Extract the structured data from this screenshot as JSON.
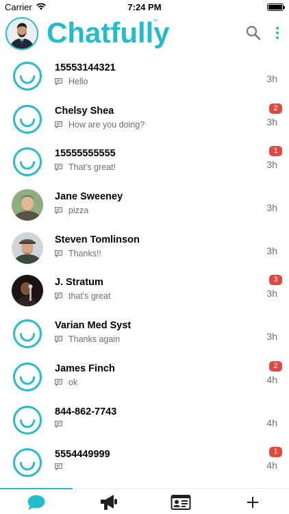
{
  "status_bar": {
    "carrier": "Carrier",
    "time": "7:24 PM"
  },
  "header": {
    "brand": "Chatfully",
    "brand_mark": "™"
  },
  "colors": {
    "accent": "#22bccd",
    "badge": "#e8453c",
    "secondary_text": "#6e6e6e"
  },
  "conversations": [
    {
      "name": "15553144321",
      "preview": "Hello",
      "time": "3h",
      "badge": "",
      "avatar": "smile-icon"
    },
    {
      "name": "Chelsy Shea",
      "preview": "How are you doing?",
      "time": "3h",
      "badge": "2",
      "avatar": "smile-icon"
    },
    {
      "name": "15555555555",
      "preview": "That's great!",
      "time": "3h",
      "badge": "1",
      "avatar": "smile-icon"
    },
    {
      "name": "Jane Sweeney",
      "preview": "pizza",
      "time": "3h",
      "badge": "",
      "avatar": "photo"
    },
    {
      "name": "Steven Tomlinson",
      "preview": "Thanks!!",
      "time": "3h",
      "badge": "",
      "avatar": "photo"
    },
    {
      "name": "J. Stratum",
      "preview": "that's great",
      "time": "3h",
      "badge": "3",
      "avatar": "photo"
    },
    {
      "name": "Varian Med Syst",
      "preview": "Thanks again",
      "time": "3h",
      "badge": "",
      "avatar": "smile-icon"
    },
    {
      "name": "James Finch",
      "preview": "ok",
      "time": "4h",
      "badge": "2",
      "avatar": "smile-icon"
    },
    {
      "name": "844-862-7743",
      "preview": "",
      "time": "4h",
      "badge": "",
      "avatar": "smile-icon"
    },
    {
      "name": "5554449999",
      "preview": "",
      "time": "4h",
      "badge": "1",
      "avatar": "smile-icon"
    }
  ],
  "tabs": [
    {
      "icon": "chat-bubble-icon",
      "active": true
    },
    {
      "icon": "megaphone-icon",
      "active": false
    },
    {
      "icon": "contact-card-icon",
      "active": false
    },
    {
      "icon": "plus-icon",
      "active": false
    }
  ]
}
